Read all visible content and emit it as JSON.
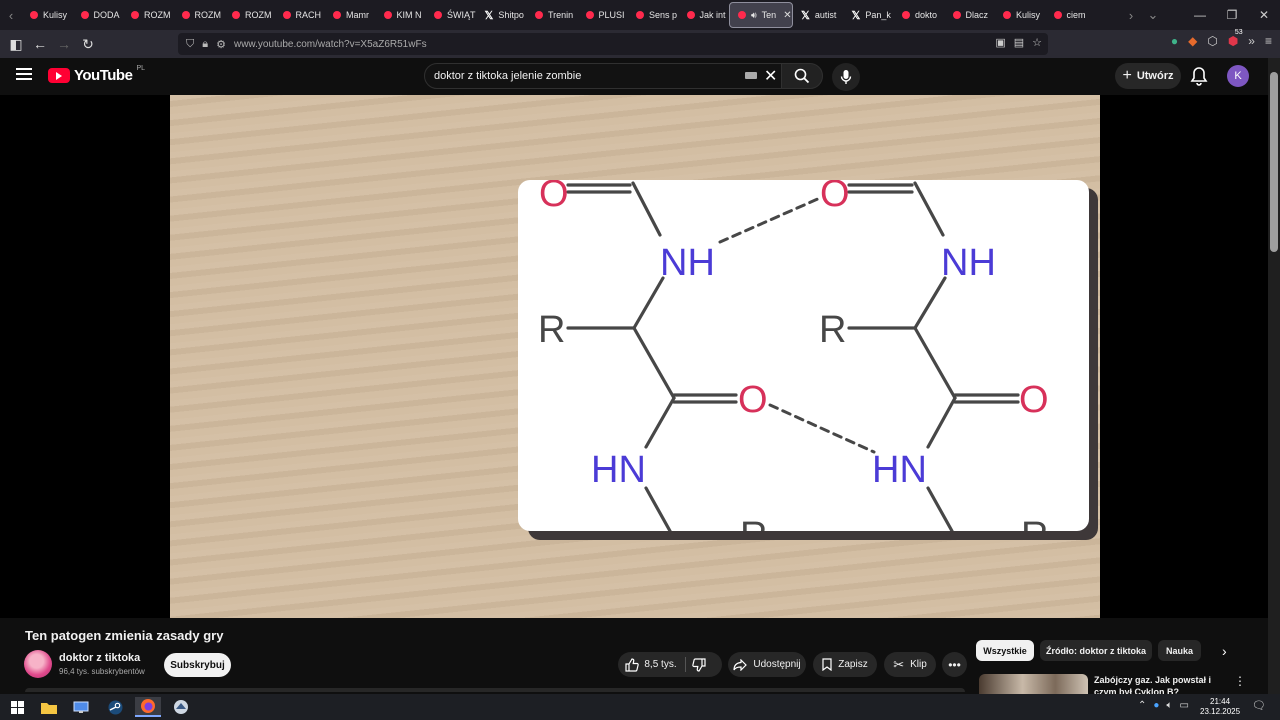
{
  "browser": {
    "tabs": [
      {
        "label": "Kulisy",
        "icon": "youtube-icon"
      },
      {
        "label": "DODA",
        "icon": "youtube-icon"
      },
      {
        "label": "ROZM",
        "icon": "youtube-icon"
      },
      {
        "label": "ROZM",
        "icon": "youtube-icon"
      },
      {
        "label": "ROZM",
        "icon": "youtube-icon"
      },
      {
        "label": "RACH",
        "icon": "youtube-icon"
      },
      {
        "label": "Mamr",
        "icon": "youtube-icon"
      },
      {
        "label": "KIM N",
        "icon": "youtube-icon"
      },
      {
        "label": "ŚWIĄT",
        "icon": "youtube-icon"
      },
      {
        "label": "Shitpo",
        "icon": "x-icon"
      },
      {
        "label": "Trenin",
        "icon": "youtube-icon"
      },
      {
        "label": "PLUSI",
        "icon": "youtube-icon"
      },
      {
        "label": "Sens p",
        "icon": "youtube-icon"
      },
      {
        "label": "Jak int",
        "icon": "youtube-icon"
      },
      {
        "label": "Ten",
        "icon": "youtube-icon",
        "active": true
      },
      {
        "label": "autist",
        "icon": "x-icon"
      },
      {
        "label": "Pan_k",
        "icon": "x-icon"
      },
      {
        "label": "dokto",
        "icon": "youtube-icon"
      },
      {
        "label": "Dlacz",
        "icon": "youtube-icon"
      },
      {
        "label": "Kulisy",
        "icon": "youtube-icon"
      },
      {
        "label": "ciem",
        "icon": "youtube-icon"
      }
    ],
    "url": "www.youtube.com/watch?v=X5aZ6R51wFs",
    "ext_badge": "53"
  },
  "youtube": {
    "region": "PL",
    "logo_text": "YouTube",
    "search_query": "doktor z tiktoka jelenie zombie",
    "create_label": "Utwórz",
    "avatar_letter": "K"
  },
  "video": {
    "title": "Ten patogen zmienia zasady gry",
    "channel": "doktor z tiktoka",
    "subscribers": "96,4 tys. subskrybentów",
    "subscribe_label": "Subskrybuj",
    "likes": "8,5 tys.",
    "share_label": "Udostępnij",
    "save_label": "Zapisz",
    "clip_label": "Klip",
    "frame_labels": {
      "o": "O",
      "nh": "NH",
      "hn": "HN",
      "r": "R"
    }
  },
  "recommendations": {
    "chips": [
      "Wszystkie",
      "Źródło: doktor z tiktoka",
      "Nauka"
    ],
    "first_title": "Zabójczy gaz. Jak powstał i czym był Cyklon B?"
  },
  "taskbar": {
    "time": "21:44",
    "date": "23.12.2025"
  },
  "colors": {
    "youtube_red": "#ff0033",
    "oxygen": "#d7315a",
    "nitrogen": "#4b3bd6",
    "carbon": "#474747"
  }
}
